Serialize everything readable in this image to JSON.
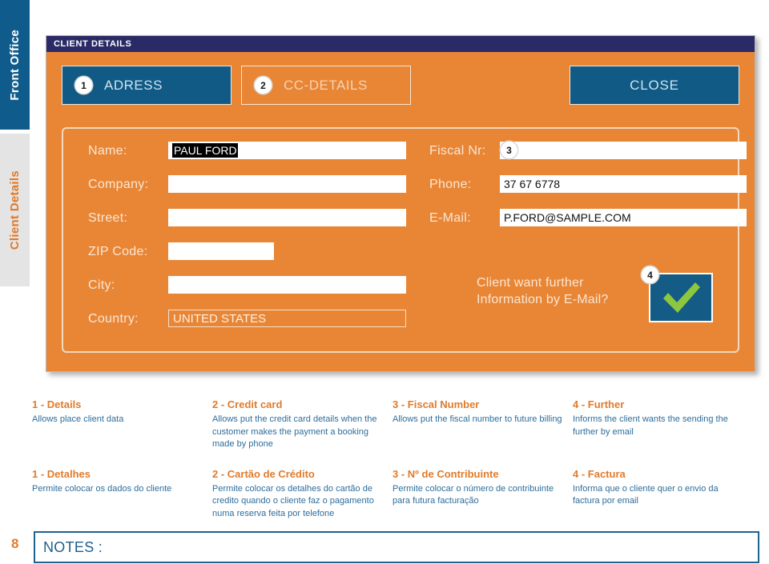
{
  "side_tabs": [
    {
      "label": "Front Office",
      "state": "active"
    },
    {
      "label": "Client Details",
      "state": "inactive"
    }
  ],
  "window": {
    "title": "CLIENT DETAILS",
    "tabs": [
      {
        "badge": "1",
        "label": "ADRESS",
        "state": "active"
      },
      {
        "badge": "2",
        "label": "CC-DETAILS",
        "state": "inactive"
      }
    ],
    "close_label": "CLOSE"
  },
  "form": {
    "left_fields": [
      {
        "label": "Name:",
        "value": "PAUL FORD",
        "selected": true,
        "type": "text"
      },
      {
        "label": "Company:",
        "value": "",
        "selected": false,
        "type": "text"
      },
      {
        "label": "Street:",
        "value": "",
        "selected": false,
        "type": "text"
      },
      {
        "label": "ZIP Code:",
        "value": "",
        "selected": false,
        "type": "text"
      },
      {
        "label": "City:",
        "value": "",
        "selected": false,
        "type": "text"
      },
      {
        "label": "Country:",
        "value": "UNITED STATES",
        "selected": false,
        "type": "combo"
      }
    ],
    "right_fields": [
      {
        "label": "Fiscal Nr:",
        "value": "",
        "badge": "3"
      },
      {
        "label": "Phone:",
        "value": "37 67 6778",
        "badge": ""
      },
      {
        "label": "E-Mail:",
        "value": "P.FORD@SAMPLE.COM",
        "badge": ""
      }
    ],
    "checkbox": {
      "question_line1": "Client want further",
      "question_line2": "Information by E-Mail?",
      "badge": "4",
      "checked": true
    }
  },
  "legend": {
    "english": [
      {
        "heading": "1 - Details",
        "body": "Allows place client data"
      },
      {
        "heading": "2 -  Credit card",
        "body": "Allows put the credit card details when the customer makes the payment a booking made by phone"
      },
      {
        "heading": "3 - Fiscal Number",
        "body": "Allows put the fiscal number to future billing"
      },
      {
        "heading": "4 - Further",
        "body": "Informs the client wants the sending the further by email"
      }
    ],
    "portuguese": [
      {
        "heading": "1 - Detalhes",
        "body": "Permite colocar os dados do cliente"
      },
      {
        "heading": "2 - Cartão de Crédito",
        "body": "Permite colocar os detalhes do cartão de credito quando o cliente faz o pagamento numa reserva feita por telefone"
      },
      {
        "heading": "3 - Nº de Contribuinte",
        "body": "Permite colocar o número de contribuinte para futura facturação"
      },
      {
        "heading": "4 - Factura",
        "body": "Informa que o cliente quer o envio da factura por email"
      }
    ]
  },
  "footer": {
    "page_number": "8",
    "notes_label": "NOTES :"
  },
  "colors": {
    "orange": "#e88636",
    "accent_orange": "#e07b2b",
    "blue": "#105a85",
    "dark_blue": "#2a2a66",
    "legend_blue": "#2e6d9b",
    "check_green": "#8dc63f"
  }
}
